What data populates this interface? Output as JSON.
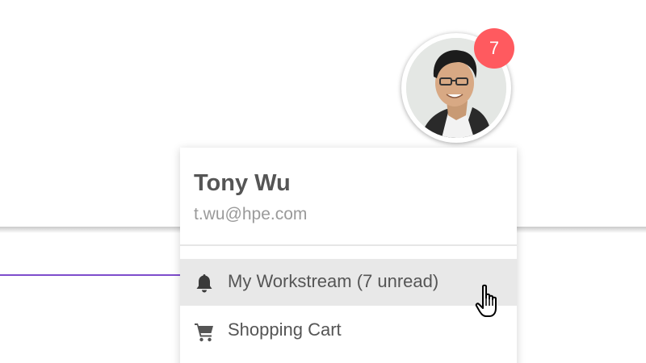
{
  "user": {
    "name": "Tony Wu",
    "email": "t.wu@hpe.com",
    "avatar_icon": "user-photo",
    "notification_count": "7"
  },
  "menu": {
    "items": [
      {
        "label": "My Workstream (7 unread)",
        "icon": "bell-icon",
        "highlighted": true
      },
      {
        "label": "Shopping Cart",
        "icon": "shopping-cart-icon",
        "highlighted": false
      }
    ]
  },
  "colors": {
    "badge": "#ff5a5f",
    "accent": "#7e4ccc",
    "highlight": "#e8e8e8",
    "text": "#555555",
    "muted": "#9a9a9a"
  }
}
